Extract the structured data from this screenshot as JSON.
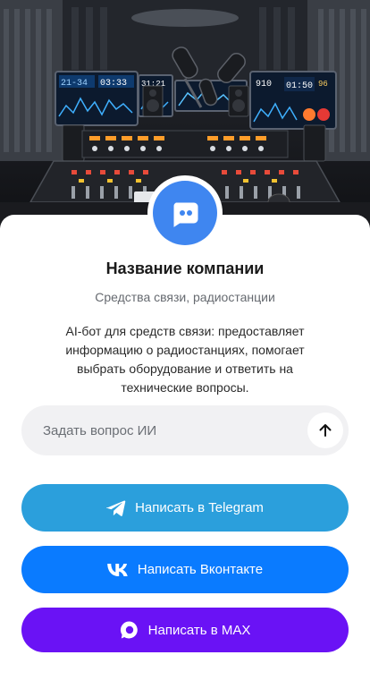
{
  "company": {
    "name": "Название компании",
    "category": "Средства связи, радиостанции",
    "description": "AI-бот для средств связи: предоставляет информацию о радиостанциях, помогает выбрать оборудование и ответить на технические вопросы."
  },
  "ask": {
    "placeholder": "Задать вопрос ИИ",
    "send_icon": "arrow-up-icon"
  },
  "buttons": {
    "telegram": {
      "label": "Написать в Telegram",
      "icon": "telegram-icon",
      "color": "#2b9fdc"
    },
    "vk": {
      "label": "Написать Вконтакте",
      "icon": "vk-icon",
      "color": "#0a7bff"
    },
    "max": {
      "label": "Написать в MAX",
      "icon": "max-icon",
      "color": "#6a12f5"
    }
  },
  "hero": {
    "screen_readouts": [
      "21-34",
      "03:33",
      "31:21",
      "910",
      "01:50",
      "96"
    ]
  },
  "colors": {
    "avatar": "#3f86f0"
  }
}
